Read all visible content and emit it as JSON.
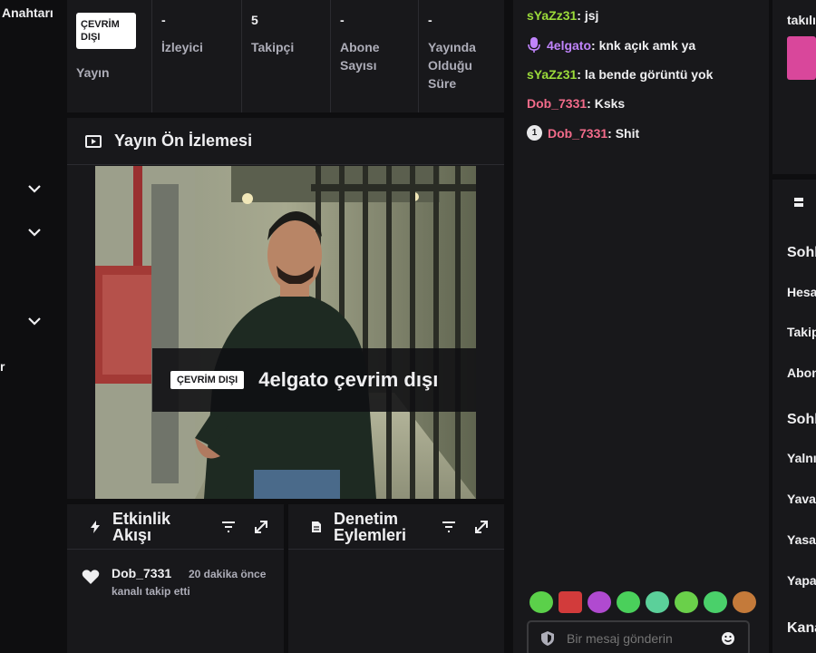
{
  "sidebar": {
    "title": "Anahtarı",
    "fragment": "r"
  },
  "stats": {
    "stream_badge": "ÇEVRİM DIŞI",
    "stream_label": "Yayın",
    "viewers_value": "-",
    "viewers_label": "İzleyici",
    "followers_value": "5",
    "followers_label": "Takipçi",
    "subs_value": "-",
    "subs_label": "Abone Sayısı",
    "uptime_value": "-",
    "uptime_label": "Yayında Olduğu Süre"
  },
  "preview": {
    "title": "Yayın Ön İzlemesi",
    "offline_badge": "ÇEVRİM DIŞI",
    "offline_text": "4elgato çevrim dışı"
  },
  "activity": {
    "title": "Etkinlik Akışı",
    "items": [
      {
        "user": "Dob_7331",
        "time": "20 dakika önce",
        "action": "kanalı takip etti"
      }
    ]
  },
  "moderation": {
    "title": "Denetim Eylemleri"
  },
  "chat": {
    "messages": [
      {
        "user": "sYaZz31",
        "color": "#9bdb3a",
        "text": ": jsj",
        "badge": ""
      },
      {
        "user": "4elgato",
        "color": "#c084fc",
        "text": ": knk açık amk ya",
        "badge": "mic"
      },
      {
        "user": "sYaZz31",
        "color": "#9bdb3a",
        "text": ": la bende görüntü yok",
        "badge": ""
      },
      {
        "user": "Dob_7331",
        "color": "#f26b8a",
        "text": ": Ksks",
        "badge": ""
      },
      {
        "user": "Dob_7331",
        "color": "#f26b8a",
        "text": ": Shit",
        "badge": "1"
      }
    ],
    "placeholder": "Bir mesaj gönderin"
  },
  "right": {
    "top_text": "takılı",
    "item_sohbet1": "Sohb",
    "item_hesap": "Hesa",
    "item_takip": "Takip",
    "item_abone": "Abon",
    "item_sohbet2": "Sohb",
    "item_yalniz": "Yalnı",
    "item_yavas": "Yava",
    "item_yasak": "Yasa",
    "item_yapay": "Yapa",
    "item_kanal": "Kana"
  }
}
